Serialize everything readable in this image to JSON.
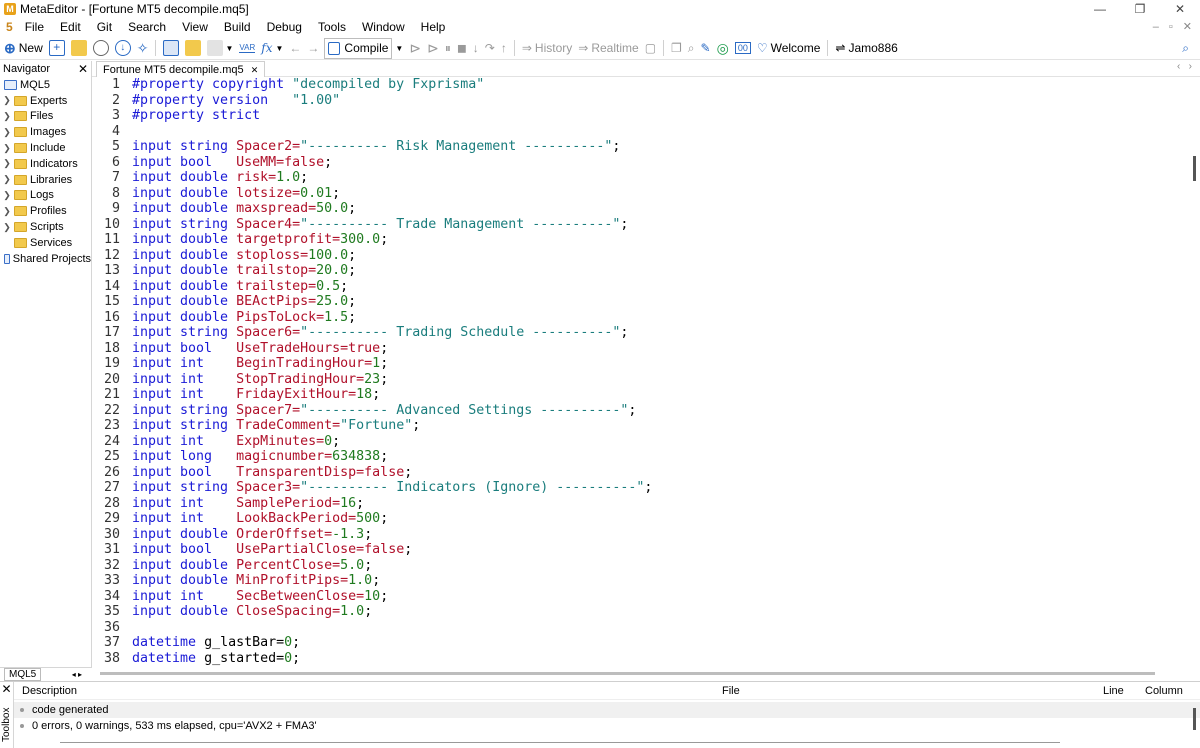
{
  "window": {
    "title": "MetaEditor - [Fortune MT5 decompile.mq5]",
    "controls": [
      "—",
      "❐",
      "✕"
    ]
  },
  "menu": {
    "items": [
      "File",
      "Edit",
      "Git",
      "Search",
      "View",
      "Build",
      "Debug",
      "Tools",
      "Window",
      "Help"
    ],
    "icon": "5"
  },
  "toolbar": {
    "new": "New",
    "compile": "Compile",
    "history": "History",
    "realtime": "Realtime",
    "welcome": "Welcome",
    "user": "Jamo886",
    "var": "VAR",
    "fx": "fx"
  },
  "navigator": {
    "title": "Navigator",
    "root": "MQL5",
    "items": [
      {
        "label": "Experts",
        "expand": true
      },
      {
        "label": "Files",
        "expand": true
      },
      {
        "label": "Images",
        "expand": true
      },
      {
        "label": "Include",
        "expand": true
      },
      {
        "label": "Indicators",
        "expand": true
      },
      {
        "label": "Libraries",
        "expand": true
      },
      {
        "label": "Logs",
        "expand": true
      },
      {
        "label": "Profiles",
        "expand": true
      },
      {
        "label": "Scripts",
        "expand": true
      },
      {
        "label": "Services",
        "expand": false
      },
      {
        "label": "Shared Projects",
        "expand": false
      }
    ],
    "tab": "MQL5"
  },
  "editor": {
    "tab": "Fortune MT5 decompile.mq5"
  },
  "code": [
    [
      [
        "pp",
        "#property copyright "
      ],
      [
        "str",
        "\"decompiled by Fxprisma\""
      ]
    ],
    [
      [
        "pp",
        "#property version   "
      ],
      [
        "str",
        "\"1.00\""
      ]
    ],
    [
      [
        "pp",
        "#property strict"
      ]
    ],
    [],
    [
      [
        "kw",
        "input string "
      ],
      [
        "id",
        "Spacer2="
      ],
      [
        "str",
        "\"---------- Risk Management ----------\""
      ],
      [
        "pl",
        ";"
      ]
    ],
    [
      [
        "kw",
        "input bool   "
      ],
      [
        "id",
        "UseMM="
      ],
      [
        "id",
        "false"
      ],
      [
        "pl",
        ";"
      ]
    ],
    [
      [
        "kw",
        "input double "
      ],
      [
        "id",
        "risk="
      ],
      [
        "num",
        "1.0"
      ],
      [
        "pl",
        ";"
      ]
    ],
    [
      [
        "kw",
        "input double "
      ],
      [
        "id",
        "lotsize="
      ],
      [
        "num",
        "0.01"
      ],
      [
        "pl",
        ";"
      ]
    ],
    [
      [
        "kw",
        "input double "
      ],
      [
        "id",
        "maxspread="
      ],
      [
        "num",
        "50.0"
      ],
      [
        "pl",
        ";"
      ]
    ],
    [
      [
        "kw",
        "input string "
      ],
      [
        "id",
        "Spacer4="
      ],
      [
        "str",
        "\"---------- Trade Management ----------\""
      ],
      [
        "pl",
        ";"
      ]
    ],
    [
      [
        "kw",
        "input double "
      ],
      [
        "id",
        "targetprofit="
      ],
      [
        "num",
        "300.0"
      ],
      [
        "pl",
        ";"
      ]
    ],
    [
      [
        "kw",
        "input double "
      ],
      [
        "id",
        "stoploss="
      ],
      [
        "num",
        "100.0"
      ],
      [
        "pl",
        ";"
      ]
    ],
    [
      [
        "kw",
        "input double "
      ],
      [
        "id",
        "trailstop="
      ],
      [
        "num",
        "20.0"
      ],
      [
        "pl",
        ";"
      ]
    ],
    [
      [
        "kw",
        "input double "
      ],
      [
        "id",
        "trailstep="
      ],
      [
        "num",
        "0.5"
      ],
      [
        "pl",
        ";"
      ]
    ],
    [
      [
        "kw",
        "input double "
      ],
      [
        "id",
        "BEActPips="
      ],
      [
        "num",
        "25.0"
      ],
      [
        "pl",
        ";"
      ]
    ],
    [
      [
        "kw",
        "input double "
      ],
      [
        "id",
        "PipsToLock="
      ],
      [
        "num",
        "1.5"
      ],
      [
        "pl",
        ";"
      ]
    ],
    [
      [
        "kw",
        "input string "
      ],
      [
        "id",
        "Spacer6="
      ],
      [
        "str",
        "\"---------- Trading Schedule ----------\""
      ],
      [
        "pl",
        ";"
      ]
    ],
    [
      [
        "kw",
        "input bool   "
      ],
      [
        "id",
        "UseTradeHours="
      ],
      [
        "id",
        "true"
      ],
      [
        "pl",
        ";"
      ]
    ],
    [
      [
        "kw",
        "input int    "
      ],
      [
        "id",
        "BeginTradingHour="
      ],
      [
        "num",
        "1"
      ],
      [
        "pl",
        ";"
      ]
    ],
    [
      [
        "kw",
        "input int    "
      ],
      [
        "id",
        "StopTradingHour="
      ],
      [
        "num",
        "23"
      ],
      [
        "pl",
        ";"
      ]
    ],
    [
      [
        "kw",
        "input int    "
      ],
      [
        "id",
        "FridayExitHour="
      ],
      [
        "num",
        "18"
      ],
      [
        "pl",
        ";"
      ]
    ],
    [
      [
        "kw",
        "input string "
      ],
      [
        "id",
        "Spacer7="
      ],
      [
        "str",
        "\"---------- Advanced Settings ----------\""
      ],
      [
        "pl",
        ";"
      ]
    ],
    [
      [
        "kw",
        "input string "
      ],
      [
        "id",
        "TradeComment="
      ],
      [
        "str",
        "\"Fortune\""
      ],
      [
        "pl",
        ";"
      ]
    ],
    [
      [
        "kw",
        "input int    "
      ],
      [
        "id",
        "ExpMinutes="
      ],
      [
        "num",
        "0"
      ],
      [
        "pl",
        ";"
      ]
    ],
    [
      [
        "kw",
        "input long   "
      ],
      [
        "id",
        "magicnumber="
      ],
      [
        "num",
        "634838"
      ],
      [
        "pl",
        ";"
      ]
    ],
    [
      [
        "kw",
        "input bool   "
      ],
      [
        "id",
        "TransparentDisp="
      ],
      [
        "id",
        "false"
      ],
      [
        "pl",
        ";"
      ]
    ],
    [
      [
        "kw",
        "input string "
      ],
      [
        "id",
        "Spacer3="
      ],
      [
        "str",
        "\"---------- Indicators (Ignore) ----------\""
      ],
      [
        "pl",
        ";"
      ]
    ],
    [
      [
        "kw",
        "input int    "
      ],
      [
        "id",
        "SamplePeriod="
      ],
      [
        "num",
        "16"
      ],
      [
        "pl",
        ";"
      ]
    ],
    [
      [
        "kw",
        "input int    "
      ],
      [
        "id",
        "LookBackPeriod="
      ],
      [
        "num",
        "500"
      ],
      [
        "pl",
        ";"
      ]
    ],
    [
      [
        "kw",
        "input double "
      ],
      [
        "id",
        "OrderOffset="
      ],
      [
        "num",
        "-1.3"
      ],
      [
        "pl",
        ";"
      ]
    ],
    [
      [
        "kw",
        "input bool   "
      ],
      [
        "id",
        "UsePartialClose="
      ],
      [
        "id",
        "false"
      ],
      [
        "pl",
        ";"
      ]
    ],
    [
      [
        "kw",
        "input double "
      ],
      [
        "id",
        "PercentClose="
      ],
      [
        "num",
        "5.0"
      ],
      [
        "pl",
        ";"
      ]
    ],
    [
      [
        "kw",
        "input double "
      ],
      [
        "id",
        "MinProfitPips="
      ],
      [
        "num",
        "1.0"
      ],
      [
        "pl",
        ";"
      ]
    ],
    [
      [
        "kw",
        "input int    "
      ],
      [
        "id",
        "SecBetweenClose="
      ],
      [
        "num",
        "10"
      ],
      [
        "pl",
        ";"
      ]
    ],
    [
      [
        "kw",
        "input double "
      ],
      [
        "id",
        "CloseSpacing="
      ],
      [
        "num",
        "1.0"
      ],
      [
        "pl",
        ";"
      ]
    ],
    [],
    [
      [
        "kw",
        "datetime "
      ],
      [
        "pl",
        "g_lastBar="
      ],
      [
        "num",
        "0"
      ],
      [
        "pl",
        ";"
      ]
    ],
    [
      [
        "kw",
        "datetime "
      ],
      [
        "pl",
        "g_started="
      ],
      [
        "num",
        "0"
      ],
      [
        "pl",
        ";"
      ]
    ]
  ],
  "toolbox": {
    "side_label": "Toolbox",
    "headers": {
      "description": "Description",
      "file": "File",
      "line": "Line",
      "column": "Column"
    },
    "rows": [
      "code generated",
      "0 errors, 0 warnings, 533 ms elapsed, cpu='AVX2 + FMA3'"
    ]
  },
  "colors": {
    "keyword": "#1a1ad6",
    "identifier": "#b0102a",
    "string": "#1a7d7d",
    "number": "#1f7a1f"
  }
}
